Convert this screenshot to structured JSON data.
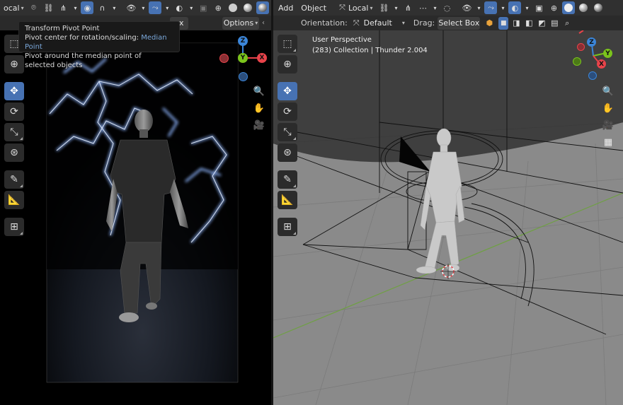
{
  "left_header": {
    "orientation_value": "ocal",
    "icons": [
      "transform-orientation-icon",
      "snap-icon",
      "proportional-icon",
      "falloff-icon",
      "visibility-icon",
      "gizmo-icon",
      "overlay-icon",
      "xray-icon",
      "shading-icons"
    ]
  },
  "left_subheader": {
    "drag_value": "ox",
    "options_label": "Options"
  },
  "tooltip": {
    "title": "Transform Pivot Point",
    "line2_prefix": "Pivot center for rotation/scaling:",
    "line2_value": "Median Point",
    "line3": "Pivot around the median point of selected objects"
  },
  "right_header": {
    "menu_add": "Add",
    "menu_object": "Object",
    "orientation_value": "Local"
  },
  "right_subheader": {
    "orientation_label": "Orientation:",
    "orientation_value": "Default",
    "drag_label": "Drag:",
    "drag_value": "Select Box"
  },
  "viewport_right": {
    "view_name": "User Perspective",
    "collection_info": "(283) Collection | Thunder 2.004"
  },
  "gizmo": {
    "z": "Z",
    "y": "Y",
    "x": "X",
    "colors": {
      "x": "#e8434a",
      "y": "#7bc41c",
      "z": "#3b85d8"
    }
  },
  "accent_color": "#4772b3"
}
